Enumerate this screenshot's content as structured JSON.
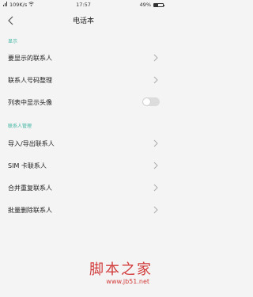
{
  "status_bar": {
    "carrier_signal": "‖",
    "speed": "109K/s",
    "time": "17:57",
    "battery": "49%",
    "battery_level": 0.49
  },
  "header": {
    "title": "电话本"
  },
  "sections": [
    {
      "label": "显示",
      "items": [
        {
          "label": "要显示的联系人",
          "control": "chevron"
        },
        {
          "label": "联系人号码整理",
          "control": "chevron"
        },
        {
          "label": "列表中显示头像",
          "control": "toggle",
          "state": "off"
        }
      ]
    },
    {
      "label": "联系人管理",
      "items": [
        {
          "label": "导入/导出联系人",
          "control": "chevron"
        },
        {
          "label": "SIM 卡联系人",
          "control": "chevron"
        },
        {
          "label": "合并重复联系人",
          "control": "chevron"
        },
        {
          "label": "批量删除联系人",
          "control": "chevron"
        }
      ]
    }
  ],
  "watermark": {
    "logo": "脚本之家",
    "url": "www.jb51.net"
  },
  "colors": {
    "accent": "#3bb3a0",
    "watermark": "#d23b3b"
  }
}
